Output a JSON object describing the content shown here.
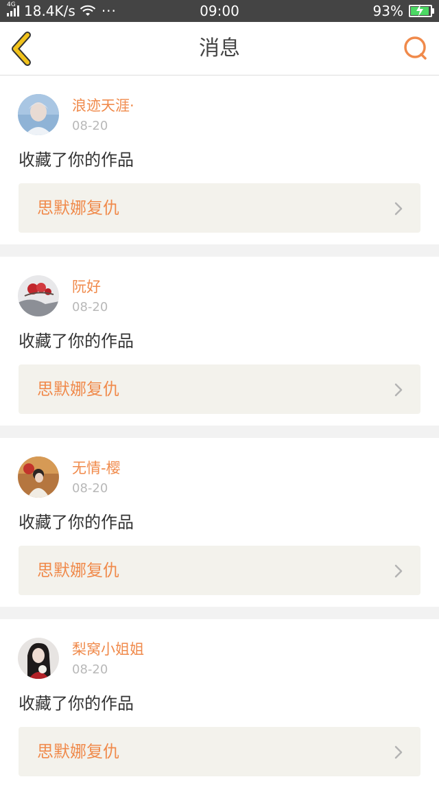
{
  "status_bar": {
    "network_type": "4G",
    "net_speed": "18.4K/s",
    "more": "···",
    "time": "09:00",
    "battery": "93%"
  },
  "nav": {
    "title": "消息",
    "back_icon": "chevron-left-icon",
    "search_icon": "search-icon"
  },
  "colors": {
    "accent": "#f08a4b",
    "back_icon": "#f1c21b"
  },
  "messages": [
    {
      "user": "浪迹天涯·",
      "date": "08-20",
      "action": "收藏了你的作品",
      "work_title": "思默娜复仇"
    },
    {
      "user": "阮好",
      "date": "08-20",
      "action": "收藏了你的作品",
      "work_title": "思默娜复仇"
    },
    {
      "user": "无情-樱",
      "date": "08-20",
      "action": "收藏了你的作品",
      "work_title": "思默娜复仇"
    },
    {
      "user": "梨窝小姐姐",
      "date": "08-20",
      "action": "收藏了你的作品",
      "work_title": "思默娜复仇"
    }
  ]
}
